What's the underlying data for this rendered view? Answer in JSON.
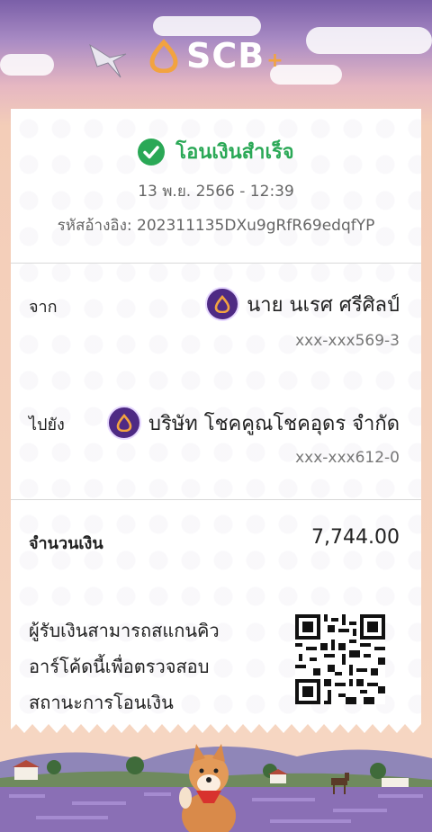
{
  "brand": {
    "name": "SCB",
    "plus": "+"
  },
  "receipt": {
    "status": "โอนเงินสำเร็จ",
    "datetime": "13 พ.ย. 2566 - 12:39",
    "reference": "รหัสอ้างอิง: 202311135DXu9gRfR69edqfYP"
  },
  "from": {
    "label": "จาก",
    "name": "นาย นเรศ ศรีศิลป์",
    "account": "xxx-xxx569-3"
  },
  "to": {
    "label": "ไปยัง",
    "name": "บริษัท โชคคูณโชคอุดร จำกัด",
    "account": "xxx-xxx612-0"
  },
  "amount": {
    "label": "จำนวนเงิน",
    "value": "7,744.00"
  },
  "qr_note": {
    "line1": "ผู้รับเงินสามารถสแกนคิว",
    "line2": "อาร์โค้ดนี้เพื่อตรวจสอบ",
    "line3": "สถานะการโอนเงิน"
  },
  "colors": {
    "success": "#2aa856",
    "scb_purple": "#4e2a84",
    "accent": "#f2a340"
  },
  "icons": {
    "status": "check-circle-icon",
    "bank": "scb-logo-icon",
    "qr": "qr-code-icon"
  }
}
